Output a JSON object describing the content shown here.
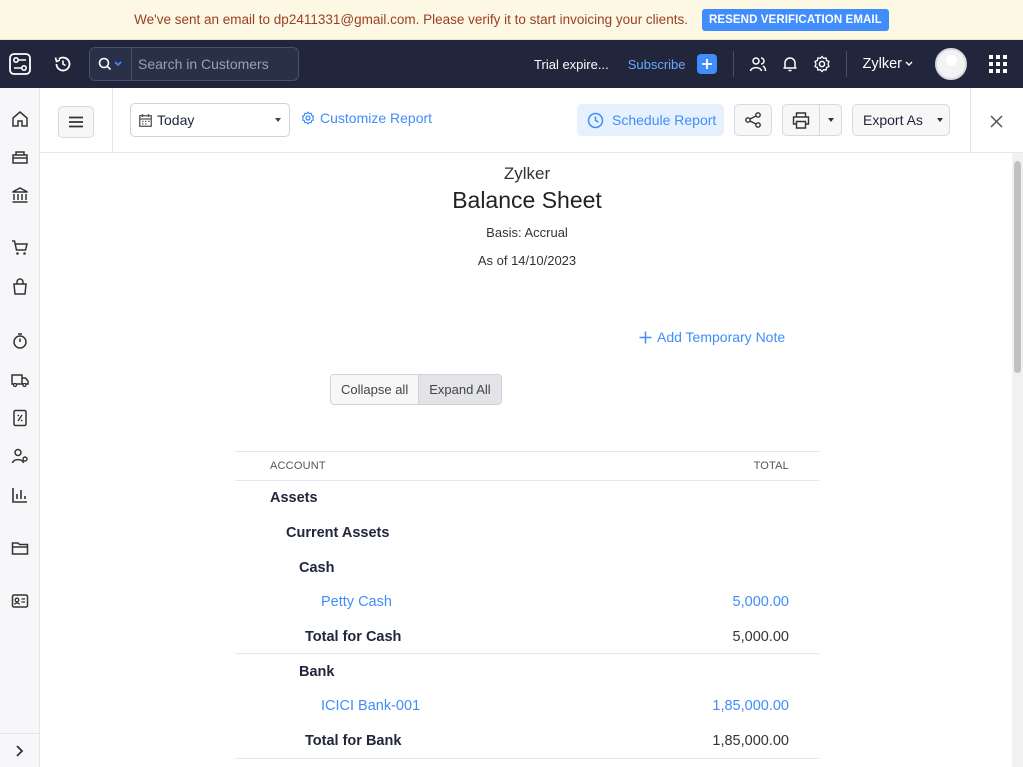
{
  "banner": {
    "message": "We've sent an email to dp2411331@gmail.com. Please verify it to start invoicing your clients.",
    "button": "RESEND VERIFICATION EMAIL"
  },
  "topbar": {
    "search_placeholder": "Search in Customers",
    "trial_text": "Trial expire...",
    "subscribe": "Subscribe",
    "org_name": "Zylker"
  },
  "toolbar": {
    "date_filter": "Today",
    "customize": "Customize Report",
    "schedule": "Schedule Report",
    "export": "Export As"
  },
  "report": {
    "org": "Zylker",
    "title": "Balance Sheet",
    "basis": "Basis: Accrual",
    "as_of": "As of 14/10/2023",
    "add_note": "Add Temporary Note",
    "collapse_all": "Collapse all",
    "expand_all": "Expand All",
    "columns": {
      "account": "ACCOUNT",
      "total": "TOTAL"
    },
    "rows": [
      {
        "label": "Assets",
        "amount": "",
        "level": "l0"
      },
      {
        "label": "Current Assets",
        "amount": "",
        "level": "l1"
      },
      {
        "label": "Cash",
        "amount": "",
        "level": "l2"
      },
      {
        "label": "Petty Cash",
        "amount": "5,000.00",
        "level": "l3"
      },
      {
        "label": "Total for Cash",
        "amount": "5,000.00",
        "level": "total"
      },
      {
        "label": "Bank",
        "amount": "",
        "level": "l2"
      },
      {
        "label": "ICICI Bank-001",
        "amount": "1,85,000.00",
        "level": "l3"
      },
      {
        "label": "Total for Bank",
        "amount": "1,85,000.00",
        "level": "total"
      }
    ]
  },
  "colors": {
    "nav_bg": "#21263c",
    "accent": "#408dfb",
    "banner_bg": "#fcf8e3"
  },
  "icons": {
    "sidebar": [
      "home-icon",
      "items-icon",
      "banking-icon",
      "sales-icon",
      "purchases-icon",
      "time-tracking-icon",
      "e-way-bills-icon",
      "gst-filing-icon",
      "accountant-icon",
      "reports-icon",
      "documents-icon",
      "payroll-icon"
    ]
  }
}
